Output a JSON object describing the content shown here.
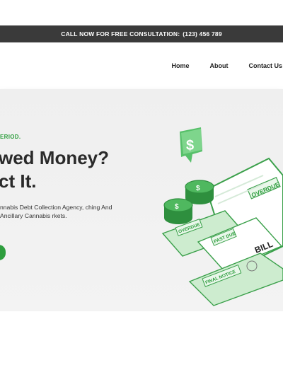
{
  "topbar": {
    "label": "CALL NOW FOR FREE CONSULTATION:",
    "phone": "(123) 456 789"
  },
  "nav": {
    "items": [
      "Home",
      "About",
      "Contact Us"
    ]
  },
  "hero": {
    "eyebrow": "ERIOD.",
    "headline_line1": "wed Money?",
    "headline_line2": "ct It.",
    "description": "nnabis Debt Collection Agency, ching And Ancillary Cannabis rkets."
  },
  "illustration": {
    "stamps": [
      "OVERDUE",
      "OVERDUE",
      "PAST DUE",
      "FINAL NOTICE",
      "BILL"
    ],
    "icon": "dollar-sign-icon"
  },
  "colors": {
    "accent": "#2e9e3e",
    "topbar": "#3a3a3a"
  }
}
